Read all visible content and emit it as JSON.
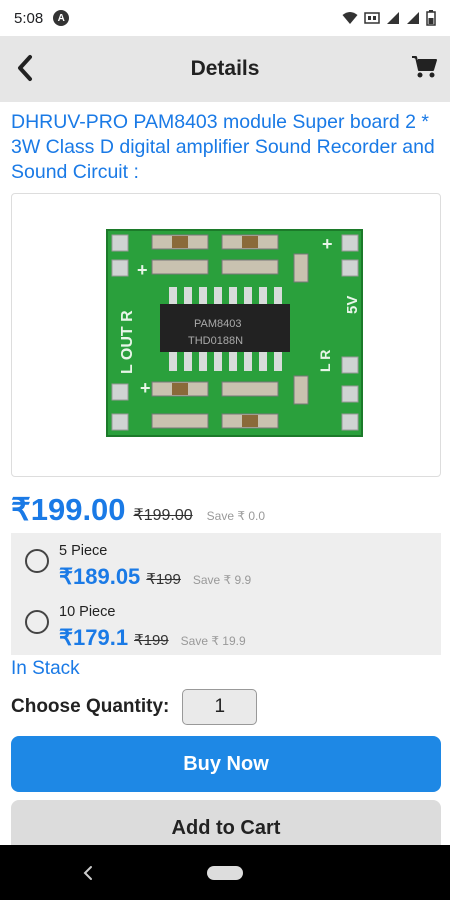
{
  "status_bar": {
    "time": "5:08",
    "app_icon": "A"
  },
  "header": {
    "title": "Details",
    "back_icon": "chevron-left-icon",
    "cart_icon": "cart-icon"
  },
  "product": {
    "title": "DHRUV-PRO PAM8403 module Super board 2 * 3W Class D digital amplifier Sound Recorder and Sound Circuit  :",
    "image_texts": {
      "chip": "PAM8403",
      "chip_code": "THD0188N",
      "left_label": "L OUT R",
      "right_label": "5V",
      "lr": "L  R"
    }
  },
  "price": {
    "current": "₹199.00",
    "mrp": "₹199.00",
    "save": "Save ₹ 0.0"
  },
  "tiers": [
    {
      "label": "5 Piece",
      "price": "₹189.05",
      "mrp": "₹199",
      "save": "Save ₹ 9.9"
    },
    {
      "label": "10 Piece",
      "price": "₹179.1",
      "mrp": "₹199",
      "save": "Save ₹ 19.9"
    }
  ],
  "stock_status": "In Stack",
  "quantity": {
    "label": "Choose Quantity:",
    "value": "1"
  },
  "buttons": {
    "buy_now": "Buy Now",
    "add_to_cart": "Add to Cart"
  },
  "colors": {
    "accent": "#1a7ae6",
    "button_blue": "#1e88e5",
    "pcb_green": "#2aa03c"
  }
}
